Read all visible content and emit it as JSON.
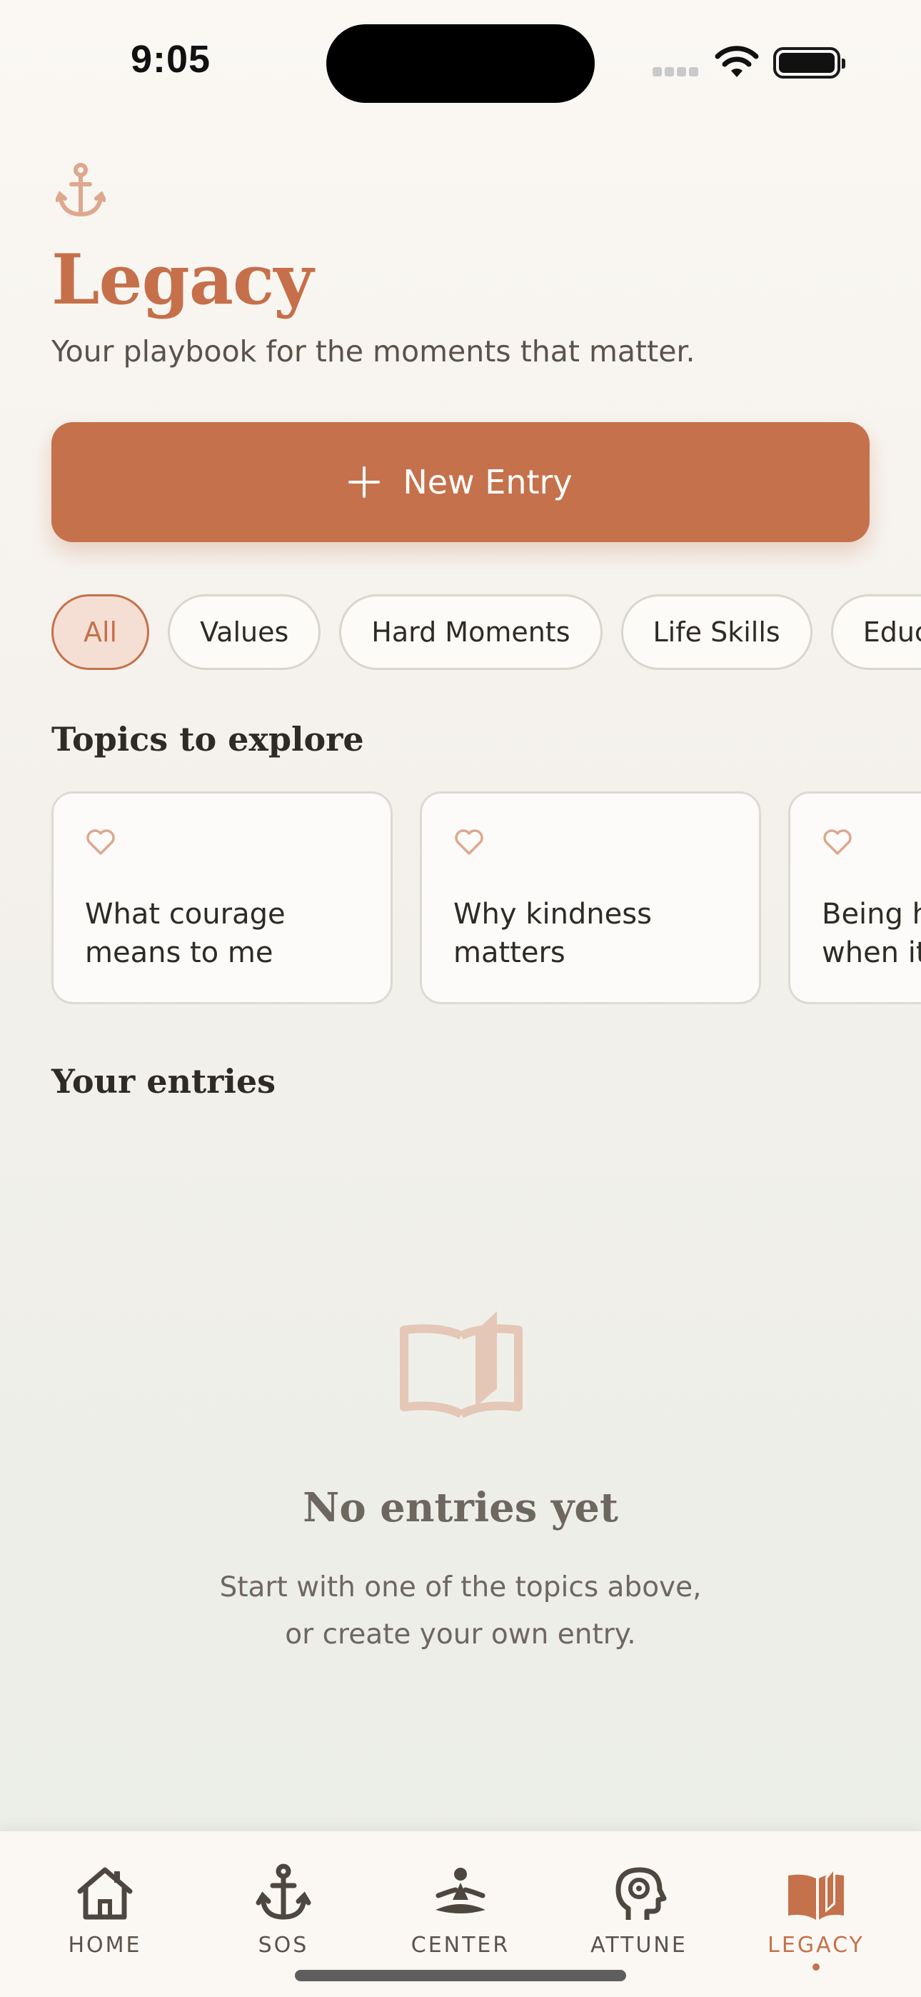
{
  "status_bar": {
    "time": "9:05"
  },
  "header": {
    "title": "Legacy",
    "subtitle": "Your playbook for the moments that matter."
  },
  "new_entry_label": "New Entry",
  "filters": [
    {
      "label": "All",
      "active": true
    },
    {
      "label": "Values",
      "active": false
    },
    {
      "label": "Hard Moments",
      "active": false
    },
    {
      "label": "Life Skills",
      "active": false
    },
    {
      "label": "Educa",
      "active": false
    }
  ],
  "topics": {
    "title": "Topics to explore",
    "cards": [
      {
        "line1": "What courage",
        "line2": "means to me"
      },
      {
        "line1": "Why kindness",
        "line2": "matters"
      },
      {
        "line1": "Being h",
        "line2": "when it"
      }
    ]
  },
  "entries": {
    "title": "Your entries",
    "empty_title": "No entries yet",
    "empty_line1": "Start with one of the topics above,",
    "empty_line2": "or create your own entry."
  },
  "tabs": [
    {
      "label": "HOME",
      "icon": "home-icon"
    },
    {
      "label": "SOS",
      "icon": "anchor-icon"
    },
    {
      "label": "CENTER",
      "icon": "meditation-icon"
    },
    {
      "label": "ATTUNE",
      "icon": "head-gear-icon"
    },
    {
      "label": "LEGACY",
      "icon": "open-book-icon",
      "active": true
    }
  ],
  "colors": {
    "accent": "#C5714B",
    "text": "#2E2A25",
    "muted": "#6E6760"
  }
}
